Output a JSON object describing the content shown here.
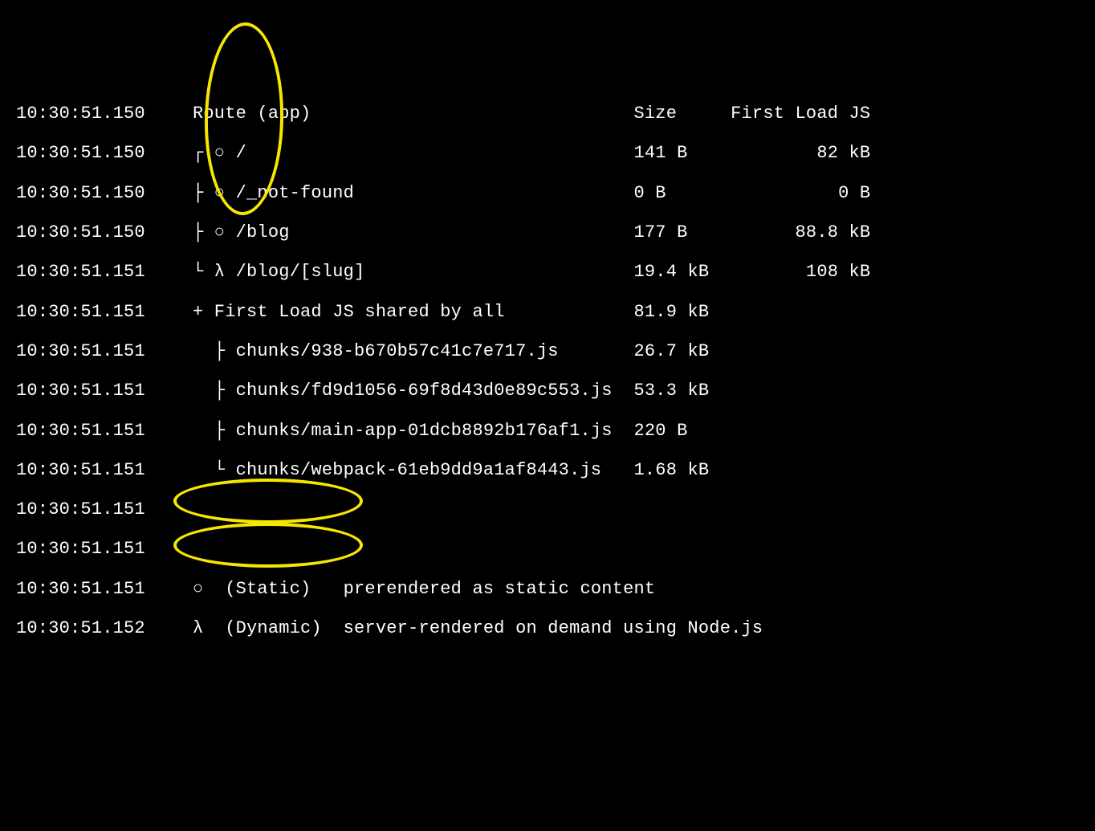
{
  "lines": [
    {
      "ts": "10:30:51.150",
      "content": "Route (app)                              Size     First Load JS"
    },
    {
      "ts": "10:30:51.150",
      "content": "┌ ○ /                                    141 B            82 kB"
    },
    {
      "ts": "10:30:51.150",
      "content": "├ ○ /_not-found                          0 B                0 B"
    },
    {
      "ts": "10:30:51.150",
      "content": "├ ○ /blog                                177 B          88.8 kB"
    },
    {
      "ts": "10:30:51.151",
      "content": "└ λ /blog/[slug]                         19.4 kB         108 kB"
    },
    {
      "ts": "10:30:51.151",
      "content": "+ First Load JS shared by all            81.9 kB"
    },
    {
      "ts": "10:30:51.151",
      "content": "  ├ chunks/938-b670b57c41c7e717.js       26.7 kB"
    },
    {
      "ts": "10:30:51.151",
      "content": "  ├ chunks/fd9d1056-69f8d43d0e89c553.js  53.3 kB"
    },
    {
      "ts": "10:30:51.151",
      "content": "  ├ chunks/main-app-01dcb8892b176af1.js  220 B"
    },
    {
      "ts": "10:30:51.151",
      "content": "  └ chunks/webpack-61eb9dd9a1af8443.js   1.68 kB"
    },
    {
      "ts": "10:30:51.151",
      "content": ""
    },
    {
      "ts": "10:30:51.151",
      "content": ""
    },
    {
      "ts": "10:30:51.151",
      "content": "○  (Static)   prerendered as static content"
    },
    {
      "ts": "10:30:51.152",
      "content": "λ  (Dynamic)  server-rendered on demand using Node.js"
    }
  ],
  "build_output": {
    "header": {
      "route_col": "Route (app)",
      "size_col": "Size",
      "first_load_col": "First Load JS"
    },
    "routes": [
      {
        "symbol": "○",
        "path": "/",
        "size": "141 B",
        "first_load": "82 kB",
        "type": "static"
      },
      {
        "symbol": "○",
        "path": "/_not-found",
        "size": "0 B",
        "first_load": "0 B",
        "type": "static"
      },
      {
        "symbol": "○",
        "path": "/blog",
        "size": "177 B",
        "first_load": "88.8 kB",
        "type": "static"
      },
      {
        "symbol": "λ",
        "path": "/blog/[slug]",
        "size": "19.4 kB",
        "first_load": "108 kB",
        "type": "dynamic"
      }
    ],
    "shared": {
      "label": "First Load JS shared by all",
      "total": "81.9 kB",
      "chunks": [
        {
          "file": "chunks/938-b670b57c41c7e717.js",
          "size": "26.7 kB"
        },
        {
          "file": "chunks/fd9d1056-69f8d43d0e89c553.js",
          "size": "53.3 kB"
        },
        {
          "file": "chunks/main-app-01dcb8892b176af1.js",
          "size": "220 B"
        },
        {
          "file": "chunks/webpack-61eb9dd9a1af8443.js",
          "size": "1.68 kB"
        }
      ]
    },
    "legend": [
      {
        "symbol": "○",
        "label": "(Static)",
        "desc": "prerendered as static content"
      },
      {
        "symbol": "λ",
        "label": "(Dynamic)",
        "desc": "server-rendered on demand using Node.js"
      }
    ]
  },
  "annotations": {
    "color": "#f7e600",
    "ovals": [
      {
        "name": "route-symbols-column"
      },
      {
        "name": "legend-static"
      },
      {
        "name": "legend-dynamic"
      }
    ]
  }
}
